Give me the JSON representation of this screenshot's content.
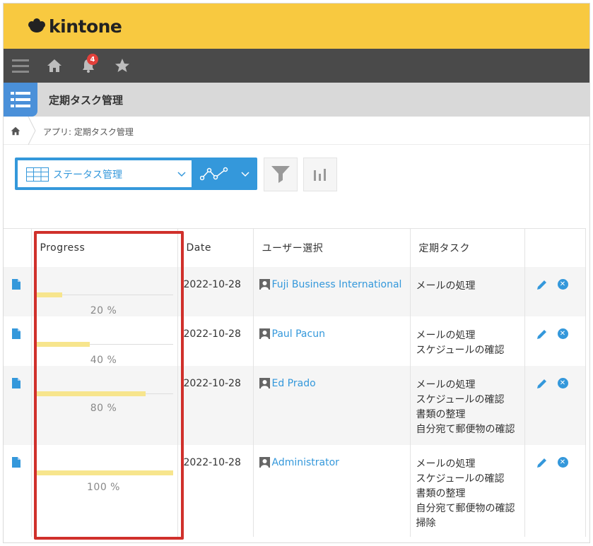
{
  "brand": {
    "name": "kintone"
  },
  "nav": {
    "notification_count": "4"
  },
  "app": {
    "title": "定期タスク管理"
  },
  "breadcrumb": {
    "text": "アプリ: 定期タスク管理"
  },
  "view_selector": {
    "selected": "ステータス管理"
  },
  "table": {
    "columns": [
      "Progress",
      "Date",
      "ユーザー選択",
      "定期タスク"
    ],
    "rows": [
      {
        "progress": 0.2,
        "progress_label": "20 %",
        "date": "2022-10-28",
        "user": "Fuji Business International",
        "tasks": [
          "メールの処理"
        ]
      },
      {
        "progress": 0.4,
        "progress_label": "40 %",
        "date": "2022-10-28",
        "user": "Paul Pacun",
        "tasks": [
          "メールの処理",
          "スケジュールの確認"
        ]
      },
      {
        "progress": 0.8,
        "progress_label": "80 %",
        "date": "2022-10-28",
        "user": "Ed Prado",
        "tasks": [
          "メールの処理",
          "スケジュールの確認",
          "書類の整理",
          "自分宛て郵便物の確認"
        ]
      },
      {
        "progress": 1.0,
        "progress_label": "100 %",
        "date": "2022-10-28",
        "user": "Administrator",
        "tasks": [
          "メールの処理",
          "スケジュールの確認",
          "書類の整理",
          "自分宛て郵便物の確認",
          "掃除"
        ]
      }
    ]
  },
  "colors": {
    "topbar": "#f8c940",
    "navbar": "#4a4a4a",
    "accent": "#3498db",
    "progress_fill": "#f7e58d",
    "highlight": "#d0302b"
  },
  "icons": [
    "hamburger-icon",
    "home-icon",
    "bell-icon",
    "star-icon",
    "list-app-icon",
    "table-view-icon",
    "chevron-down-icon",
    "graph-icon",
    "filter-icon",
    "bar-chart-icon",
    "document-icon",
    "user-icon",
    "edit-icon",
    "delete-icon"
  ]
}
